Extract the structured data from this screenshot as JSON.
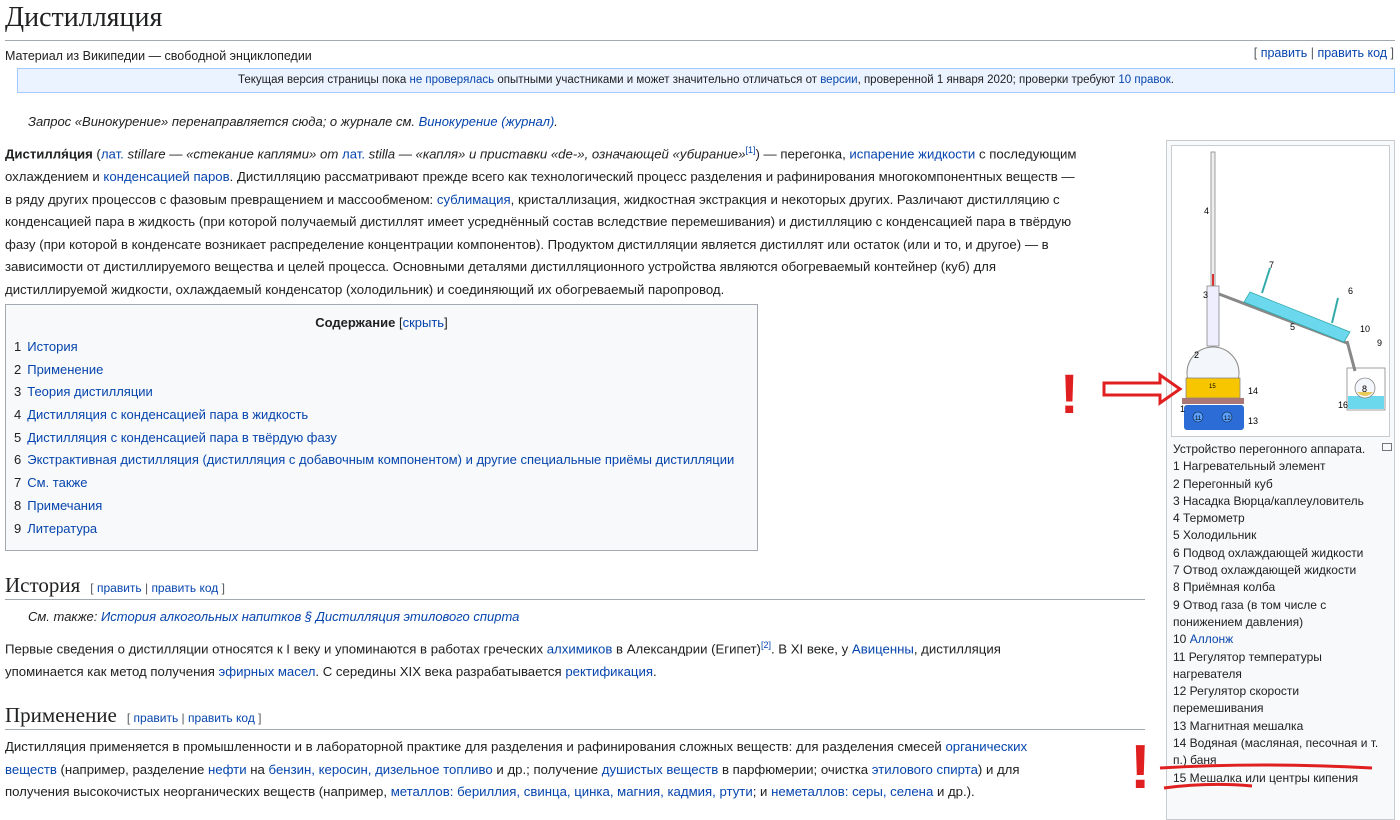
{
  "page": {
    "title": "Дистилляция",
    "site_sub": "Материал из Википедии — свободной энциклопедии",
    "edit": "править",
    "edit_code": "править код"
  },
  "notice": {
    "prefix": "Текущая версия страницы пока ",
    "link1": "не проверялась",
    "mid": " опытными участниками и может значительно отличаться от ",
    "link2": "версии",
    "mid2": ", проверенной 1 января 2020; проверки требуют ",
    "link3": "10 правок",
    "suffix": "."
  },
  "hatnote": {
    "text": "Запрос «Винокурение» перенаправляется сюда; о журнале см. ",
    "link": "Винокурение (журнал)",
    "suffix": "."
  },
  "intro": {
    "term": "Дистилля́ция",
    "s1": " (",
    "l1": "лат.",
    "s2": " stillare — «стекание каплями» от ",
    "l2": "лат.",
    "s3": " stilla — «капля» и приставки «de-», означающей «убирание»",
    "ref1": "[1]",
    "s4": ") — перегонка, ",
    "l3": "испарение жидкости",
    "s5": " с последующим",
    "line2a": "охлаждением и ",
    "l4": "конденсацией паров",
    "line2b": ". Дистилляцию рассматривают прежде всего как технологический процесс разделения и рафинирования многокомпонентных веществ —",
    "line3a": "в ряду других процессов с фазовым превращением и массообменом: ",
    "l5": "сублимация",
    "line3b": ", кристаллизация, жидкостная экстракция и некоторых других. Различают дистилляцию с",
    "line4": "конденсацией пара в жидкость (при которой получаемый дистиллят имеет усреднённый состав вследствие перемешивания) и дистилляцию с конденсацией пара в твёрдую",
    "line5": "фазу (при которой в конденсате возникает распределение концентрации компонентов). Продуктом дистилляции является дистиллят или остаток (или и то, и другое) — в",
    "line6": "зависимости от дистиллируемого вещества и целей процесса. Основными деталями дистилляционного устройства являются обогреваемый контейнер (куб) для",
    "line7": "дистиллируемой жидкости, охлаждаемый конденсатор (холодильник) и соединяющий их обогреваемый паропровод."
  },
  "toc": {
    "title": "Содержание",
    "hide": "скрыть",
    "items": [
      {
        "num": "1",
        "label": "История"
      },
      {
        "num": "2",
        "label": "Применение"
      },
      {
        "num": "3",
        "label": "Теория дистилляции"
      },
      {
        "num": "4",
        "label": "Дистилляция с конденсацией пара в жидкость"
      },
      {
        "num": "5",
        "label": "Дистилляция с конденсацией пара в твёрдую фазу"
      },
      {
        "num": "6",
        "label": "Экстрактивная дистилляция (дистилляция с добавочным компонентом) и другие специальные приёмы дистилляции"
      },
      {
        "num": "7",
        "label": "См. также"
      },
      {
        "num": "8",
        "label": "Примечания"
      },
      {
        "num": "9",
        "label": "Литература"
      }
    ]
  },
  "history": {
    "heading": "История",
    "seealso_prefix": "См. также: ",
    "seealso_link": "История алкогольных напитков § Дистилляция этилового спирта",
    "a1": "Первые сведения о дистилляции относятся к I веку и упоминаются в работах греческих ",
    "l1": "алхимиков",
    "a2": " в Александрии (Египет)",
    "ref2": "[2]",
    "a3": ". В XI веке, у ",
    "l2": "Авиценны",
    "a4": ", дистилляция",
    "b1": "упоминается как метод получения ",
    "l3": "эфирных масел",
    "b2": ". С середины XIX века разрабатывается ",
    "l4": "ректификация",
    "b3": "."
  },
  "application": {
    "heading": "Применение",
    "a1": "Дистилляция применяется в промышленности и в лабораторной практике для разделения и рафинирования сложных веществ: для разделения смесей ",
    "l1": "органических",
    "l1b": "веществ",
    "b1": " (например, разделение ",
    "l2": "нефти",
    "b2": " на ",
    "l3": "бензин, керосин, дизельное топливо",
    "b3": " и др.; получение ",
    "l4": "душистых веществ",
    "b4": " в парфюмерии; очистка ",
    "l5": "этилового спирта",
    "b5": ") и для",
    "c1": "получения высокочистых неорганических веществ (например, ",
    "l6": "металлов: бериллия, свинца, цинка, магния, кадмия, ртути",
    "c2": "; и ",
    "l7": "неметаллов: серы, селена",
    "c3": " и др.)."
  },
  "figure": {
    "labels": [
      "1",
      "2",
      "3",
      "4",
      "5",
      "6",
      "7",
      "8",
      "9",
      "10",
      "11",
      "12",
      "13",
      "14",
      "15",
      "16"
    ],
    "caption_title": "Устройство перегонного аппарата.",
    "items": [
      "1 Нагревательный элемент",
      "2 Перегонный куб",
      "3 Насадка Вюрца/каплеуловитель",
      "4 Термометр",
      "5 Холодильник",
      "6 Подвод охлаждающей жидкости",
      "7 Отвод охлаждающей жидкости",
      "8 Приёмная колба",
      "9 Отвод газа (в том числе с понижением давления)",
      "10 ",
      "11 Регулятор температуры нагревателя",
      "12 Регулятор скорости перемешивания",
      "13 Магнитная мешалка",
      "14 Водяная (масляная, песочная и т. п.) баня",
      "15 Мешалка или центры кипения"
    ],
    "item10_link": "Аллонж"
  },
  "annotations": {
    "mark": "!"
  }
}
